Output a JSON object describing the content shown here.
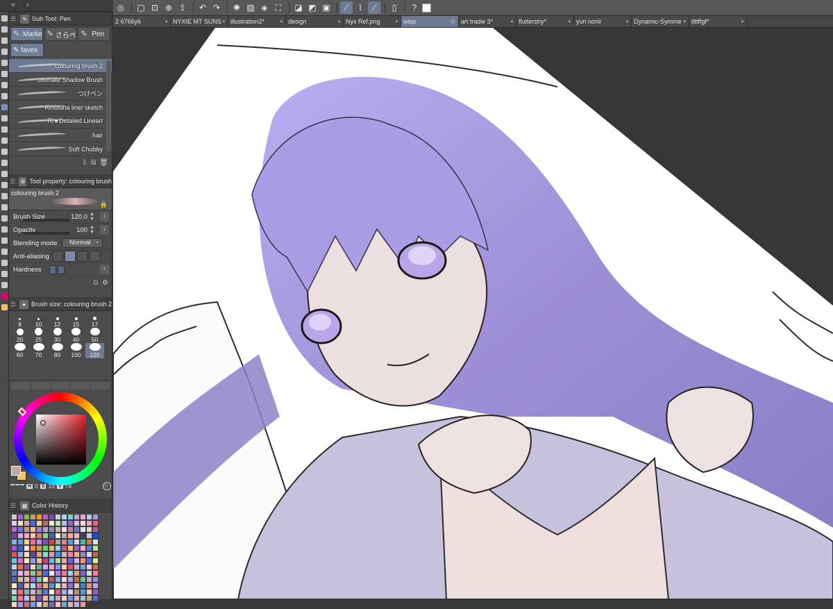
{
  "top_dock": {
    "collapse": "«",
    "back": "‹"
  },
  "subtool": {
    "title": "Sub Tool: Pen",
    "categories": [
      {
        "label": "Marke",
        "icon": "✎"
      },
      {
        "label": "さらぺ",
        "icon": "✎"
      },
      {
        "label": "Pen",
        "icon": "✎"
      }
    ],
    "faves_label": "faves",
    "brushes": [
      {
        "label": "colouring brush 2",
        "selected": true
      },
      {
        "label": "Ultimate Shadow Brush"
      },
      {
        "label": "つけペン"
      },
      {
        "label": "Rinotuna line/ sketch"
      },
      {
        "label": "Ri★Detailed Lineart"
      },
      {
        "label": "hair"
      },
      {
        "label": "Soft Chubby"
      }
    ]
  },
  "tool_property": {
    "title": "Tool property: colouring brush",
    "preview_label": "colouring brush 2",
    "brush_size": {
      "label": "Brush Size",
      "value": "120.0"
    },
    "opacity": {
      "label": "Opacity",
      "value": "100"
    },
    "blending_mode": {
      "label": "Blending mode",
      "value": "Normal"
    },
    "anti_aliasing": {
      "label": "Anti-aliasing"
    },
    "hardness": {
      "label": "Hardness"
    }
  },
  "brush_size_panel": {
    "title": "Brush size: colouring brush 2",
    "sizes": [
      "8",
      "10",
      "12",
      "15",
      "17",
      "20",
      "25",
      "30",
      "40",
      "50",
      "60",
      "70",
      "80",
      "100",
      "120"
    ],
    "selected": "120"
  },
  "color_wheel": {
    "h_label": "H",
    "h": "0",
    "s_label": "S",
    "s": "15",
    "v_label": "V",
    "v": "78",
    "main_color": "#c6a8a0",
    "sub_color": "#f2c66e"
  },
  "color_history": {
    "title": "Color History",
    "colors": [
      "#d8c4c0",
      "#b15cc8",
      "#5fd23a",
      "#c0a070",
      "#ff9a00",
      "#c85cc0",
      "#6a4bd0",
      "#d0d0e0",
      "#a4d8f0",
      "#70d8c8",
      "#c0a0e8",
      "#e0b0d0",
      "#b8c8f0",
      "#9aa0e0",
      "#e7c6ff",
      "#f2e0c8",
      "#e0a0a8",
      "#4a6cd8",
      "#e8d0a0",
      "#a87070",
      "#f0f0d8",
      "#c8e0b0",
      "#b0c0f0",
      "#8868c8",
      "#d8c0e8",
      "#ffd0e0",
      "#e8a8b8",
      "#e06090",
      "#c060e0",
      "#7a6ae8",
      "#c89870",
      "#f0c0a0",
      "#b078d0",
      "#a8a8c8",
      "#8090d0",
      "#c8b8a8",
      "#f0e0e8",
      "#c080a0",
      "#6878d8",
      "#e0e0e0",
      "#f8d0c0",
      "#a06898",
      "#7840a8",
      "#d8a8e8",
      "#f0a8c8",
      "#f8c8a8",
      "#d87878",
      "#a0c8a0",
      "#5060b0",
      "#f0f0f0",
      "#b0b0b8",
      "#ffb0a0",
      "#e8b8c8",
      "#404060",
      "#c8c8f0",
      "#2050d0",
      "#80b0f0",
      "#6a98e8",
      "#ffd870",
      "#f070a0",
      "#c090f0",
      "#8050c0",
      "#e04040",
      "#a8a8a8",
      "#f08080",
      "#60a0e0",
      "#f0c8e0",
      "#40c0a0",
      "#e07820",
      "#d8e0ff",
      "#b050e0",
      "#3060c8",
      "#ffe0f0",
      "#ff8a50",
      "#c8a060",
      "#70d070",
      "#e0c060",
      "#90d8f0",
      "#d05090",
      "#ffc080",
      "#a060d0",
      "#f0b0e0",
      "#5080e0",
      "#c0e0a0",
      "#e85050",
      "#a0a0f0",
      "#f8e8b0",
      "#6040a0",
      "#e0a070",
      "#80e0d0",
      "#f090b0",
      "#4090f0",
      "#c0c0c0",
      "#ff70c0",
      "#ffb060",
      "#8088d8",
      "#e0d0ff",
      "#b07050",
      "#60c8e8",
      "#d870d0",
      "#f0f0a0",
      "#90a0e0",
      "#e8c0a0",
      "#c04080",
      "#70b0f0",
      "#a8e0b0",
      "#f8a0a0",
      "#7060d0",
      "#d0b0f0",
      "#ff9090",
      "#3878e8",
      "#e0e8a0",
      "#b8d8f8",
      "#f07040",
      "#9050c8",
      "#e8d8c8",
      "#50b8a0",
      "#c8a8f0",
      "#f0a0d0",
      "#8098f8",
      "#ffd0a0",
      "#e05070",
      "#b8b8e0",
      "#70a8d8",
      "#f8c0e8",
      "#c87840",
      "#6080c0",
      "#e0b8f0",
      "#ffa8c0",
      "#90c0a0",
      "#d89050",
      "#5070d8",
      "#f0e8f8",
      "#b880d8",
      "#f87890",
      "#a0d0f0",
      "#e8a080",
      "#7868b8",
      "#c8e8d8",
      "#ff80a0",
      "#4868c0",
      "#d0c0b0",
      "#f0b890",
      "#a070e0",
      "#60d0c0",
      "#e8e8b8",
      "#c05060",
      "#88a8f0",
      "#f8d8e0",
      "#b0a0d8",
      "#e06040",
      "#70c090",
      "#d8a0c0",
      "#9090e8",
      "#ffe8c0",
      "#5858a8",
      "#f0c0c0",
      "#a8d8e8",
      "#c878b0",
      "#e8b080",
      "#6890e0",
      "#d0e8c0",
      "#f8a8d8",
      "#8870c8",
      "#e0c8b0",
      "#4080d0",
      "#f09070",
      "#b8a8f0",
      "#c8d0e8",
      "#ff6878",
      "#70b8c8",
      "#e0a8e0",
      "#a8a080",
      "#6070e8",
      "#f8f0d0",
      "#d06898",
      "#90b8f0",
      "#e8c8f0",
      "#c09060",
      "#5898e0",
      "#f0d0b0",
      "#a858c8",
      "#78d8b8",
      "#e87898",
      "#b8c0f8",
      "#d8b0a0",
      "#6858c0",
      "#f8b8b0",
      "#88c8e8",
      "#c0a8c8",
      "#ffc8d8",
      "#7890d8",
      "#e8a8c0",
      "#a0c0e0",
      "#d0a878",
      "#5870c8",
      "#f0e0c0",
      "#b890e0",
      "#e06878",
      "#70a0e8",
      "#d8d0f0",
      "#c8b088",
      "#8060d0",
      "#f8c8c0",
      "#60b0d8",
      "#e0b0c8",
      "#a8b8e8",
      "#f09890"
    ]
  },
  "topbar_icons": [
    "logo-icon",
    "new-icon",
    "open-icon",
    "save-icon",
    "export-icon",
    "undo-icon",
    "redo-icon",
    "busy-icon",
    "clear-icon",
    "fill-icon",
    "transform-icon",
    "grid-a-icon",
    "grid-b-icon",
    "grid-c-icon",
    "ruler-icon",
    "ruler-snap-icon",
    "brush-snap-icon",
    "device-icon",
    "help-icon",
    "color-icon"
  ],
  "doc_tabs": [
    {
      "label": "2 6766y6"
    },
    {
      "label": "NYXIE MT SUNS"
    },
    {
      "label": "illustration2*"
    },
    {
      "label": "design"
    },
    {
      "label": "Nyx Ref.png"
    },
    {
      "label": "wisp",
      "active": true
    },
    {
      "label": "art tradw 3*"
    },
    {
      "label": "fluttershy*"
    },
    {
      "label": "yuri noriii"
    },
    {
      "label": "Dynamic-Symme"
    },
    {
      "label": "itttffgf*"
    }
  ],
  "canvas": {
    "artwork": "anime girl with lavender hair lying on pillow"
  }
}
